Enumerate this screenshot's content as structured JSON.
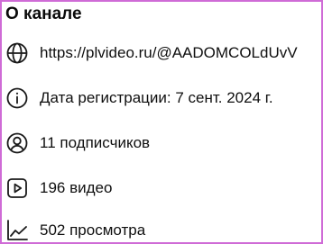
{
  "about": {
    "title": "О канале",
    "items": [
      {
        "icon": "globe-icon",
        "text": "https://plvideo.ru/@AADOMCOLdUvV"
      },
      {
        "icon": "info-icon",
        "text": "Дата регистрации: 7 сент. 2024 г."
      },
      {
        "icon": "user-circle-icon",
        "text": "11 подписчиков"
      },
      {
        "icon": "play-square-icon",
        "text": "196 видео"
      },
      {
        "icon": "trend-chart-icon",
        "text": "502 просмотра"
      }
    ]
  },
  "colors": {
    "frame_border": "#cf6bd6",
    "text": "#0f0f0f"
  }
}
